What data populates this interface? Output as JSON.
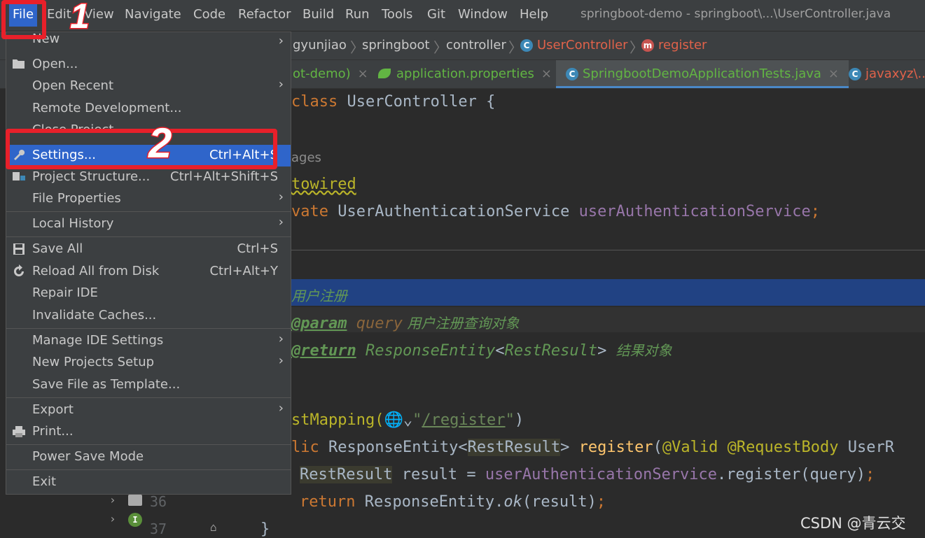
{
  "menubar": {
    "items": [
      "File",
      "Edit",
      "View",
      "Navigate",
      "Code",
      "Refactor",
      "Build",
      "Run",
      "Tools",
      "Git",
      "Window",
      "Help"
    ],
    "window_title": "springboot-demo - springboot\\...\\UserController.java"
  },
  "breadcrumb": {
    "items": [
      "gyunjiao",
      "springboot",
      "controller",
      "UserController",
      "register"
    ]
  },
  "tabs": [
    {
      "label": "ot-demo)",
      "close": "×"
    },
    {
      "label": "application.properties",
      "close": "×"
    },
    {
      "label": "SpringbootDemoApplicationTests.java",
      "close": "×"
    },
    {
      "label": "javaxyz\\...",
      "close": ""
    }
  ],
  "code": {
    "line_class_kw": "class",
    "line_class_name": " UserController {",
    "usages": "ages",
    "autowired": "towired",
    "field_kw": "vate",
    "field_type": " UserAuthenticationService ",
    "field_name": "userAuthenticationService",
    "field_semi": ";",
    "doc1": "用户注册",
    "doc_param_tag": "@param",
    "doc_param_name": " query",
    "doc_param_desc": " 用户注册查询对象",
    "doc_return_tag": "@return",
    "doc_return_type": " ResponseEntity",
    "doc_return_lt": "<",
    "doc_return_generic": "RestResult",
    "doc_return_gt": "> ",
    "doc_return_desc": "结果对象",
    "mapping_ann": "stMapping(",
    "mapping_str_q1": "\"",
    "mapping_str": "/register",
    "mapping_str_q2": "\"",
    "mapping_close": ")",
    "method_kw": "lic",
    "method_type": " ResponseEntity<",
    "method_generic": "RestResult",
    "method_gt": "> ",
    "method_name": "register",
    "method_paren": "(",
    "method_ann1": "@Valid",
    "method_ann2": " @RequestBody",
    "method_rest": " UserR",
    "body1_type": "RestResult",
    "body1_rest": " result = ",
    "body1_field": "userAuthenticationService",
    "body1_call": ".register(query)",
    "body1_semi": ";",
    "body2_kw": "return",
    "body2_rest": " ResponseEntity.",
    "body2_ok": "ok",
    "body2_end": "(result)",
    "body2_semi": ";",
    "close_brace": "}",
    "gutter_36": "36",
    "gutter_37": "37"
  },
  "file_menu": {
    "new": "New",
    "open": "Open...",
    "open_recent": "Open Recent",
    "remote_dev": "Remote Development...",
    "close_project": "Close Project",
    "settings": "Settings...",
    "settings_shortcut": "Ctrl+Alt+S",
    "project_structure": "Project Structure...",
    "project_structure_shortcut": "Ctrl+Alt+Shift+S",
    "file_properties": "File Properties",
    "local_history": "Local History",
    "save_all": "Save All",
    "save_all_shortcut": "Ctrl+S",
    "reload": "Reload All from Disk",
    "reload_shortcut": "Ctrl+Alt+Y",
    "repair": "Repair IDE",
    "invalidate": "Invalidate Caches...",
    "manage_settings": "Manage IDE Settings",
    "new_projects_setup": "New Projects Setup",
    "save_template": "Save File as Template...",
    "export": "Export",
    "print": "Print...",
    "power_save": "Power Save Mode",
    "exit": "Exit"
  },
  "annotations": {
    "step1": "1",
    "step2": "2"
  },
  "watermark": "CSDN @青云交",
  "colors": {
    "accent": "#2f65ca",
    "annotation_red": "#e8202a",
    "background": "#2b2b2b",
    "chrome": "#3c3f41"
  }
}
